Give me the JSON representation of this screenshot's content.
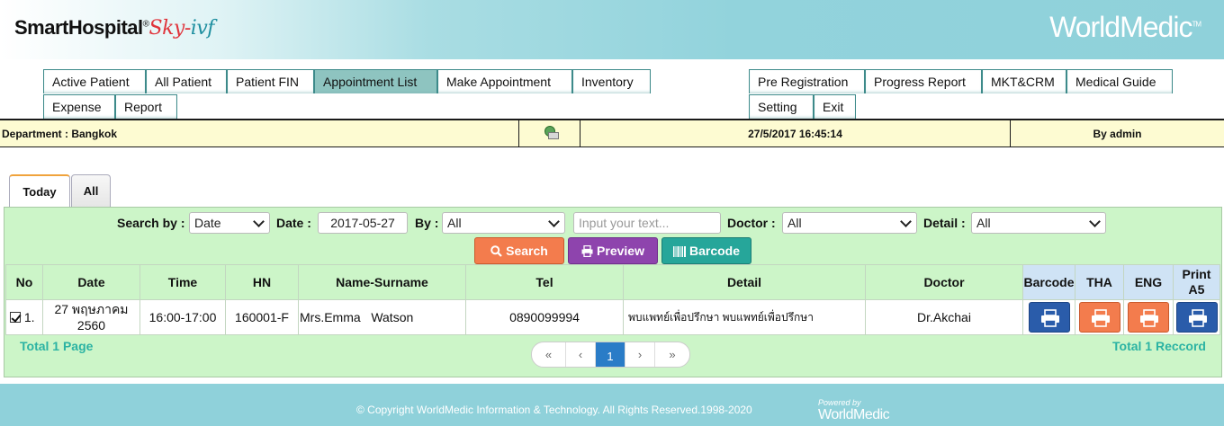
{
  "header": {
    "logo_main": "SmartHospital",
    "logo_reg": "®",
    "logo_sky": "Sky-",
    "logo_ivf": "ivf",
    "brand": "WorldMedic",
    "brand_tm": "TM"
  },
  "menu": {
    "left_row1": [
      "Active Patient",
      "All Patient",
      "Patient FIN",
      "Appointment List",
      "Make Appointment",
      "Inventory"
    ],
    "left_row2": [
      "Expense",
      "Report"
    ],
    "right_row1": [
      "Pre Registration",
      "Progress Report",
      "MKT&CRM",
      "Medical Guide"
    ],
    "right_row2": [
      "Setting",
      "Exit"
    ],
    "active": "Appointment List"
  },
  "status": {
    "department": "Department : Bangkok",
    "datetime": "27/5/2017 16:45:14",
    "user": "By admin"
  },
  "tabs": {
    "today": "Today",
    "all": "All"
  },
  "search": {
    "search_by_label": "Search by :",
    "search_by_value": "Date",
    "date_label": "Date :",
    "date_value": "2017-05-27",
    "by_label": "By :",
    "by_value": "All",
    "text_placeholder": "Input your text...",
    "doctor_label": "Doctor :",
    "doctor_value": "All",
    "detail_label": "Detail :",
    "detail_value": "All",
    "search_btn": "Search",
    "preview_btn": "Preview",
    "barcode_btn": "Barcode"
  },
  "table": {
    "columns": [
      "No",
      "Date",
      "Time",
      "HN",
      "Name-Surname",
      "Tel",
      "Detail",
      "Doctor",
      "Barcode",
      "THA",
      "ENG",
      "Print A5"
    ],
    "rows": [
      {
        "no": "1.",
        "date": "27 พฤษภาคม 2560",
        "time": "16:00-17:00",
        "hn": "160001-F",
        "name": "Mrs.Emma   Watson",
        "tel": "0890099994",
        "detail": "พบแพทย์เพื่อปรึกษา พบแพทย์เพื่อปรึกษา",
        "doctor": "Dr.Akchai"
      }
    ]
  },
  "summary": {
    "total_page": "Total 1 Page",
    "total_record": "Total 1 Reccord"
  },
  "pager": {
    "first": "«",
    "prev": "‹",
    "current": "1",
    "next": "›",
    "last": "»"
  },
  "footer": {
    "copyright": "© Copyright WorldMedic Information & Technology. All Rights Reserved.1998-2020",
    "powered": "Powered by",
    "powered_brand": "WorldMedic"
  }
}
